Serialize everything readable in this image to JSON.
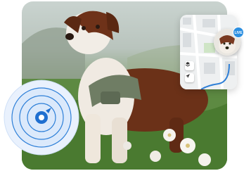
{
  "photo": {
    "subject": "dog-photo",
    "colors": {
      "sky": "#c9d3cf",
      "grass": "#4f7a38",
      "fur_brown": "#7a3a20",
      "fur_white": "#f2ede6",
      "harness": "#6f7d64"
    }
  },
  "map": {
    "colors": {
      "base": "#eef0f1",
      "route": "#2f7fd6",
      "block": "#d9dde0",
      "green": "#cfe5c6"
    },
    "controls": [
      {
        "icon": "layers-icon"
      },
      {
        "icon": "locate-icon"
      }
    ]
  },
  "tracker": {
    "badge_label": "LIVE",
    "avatar_icon": "dog-avatar"
  },
  "radar": {
    "icon": "location-pin-icon",
    "colors": {
      "ring": "#2d7fd8",
      "fill": "#dbe9fb",
      "dot": "#1f6fd0"
    }
  }
}
